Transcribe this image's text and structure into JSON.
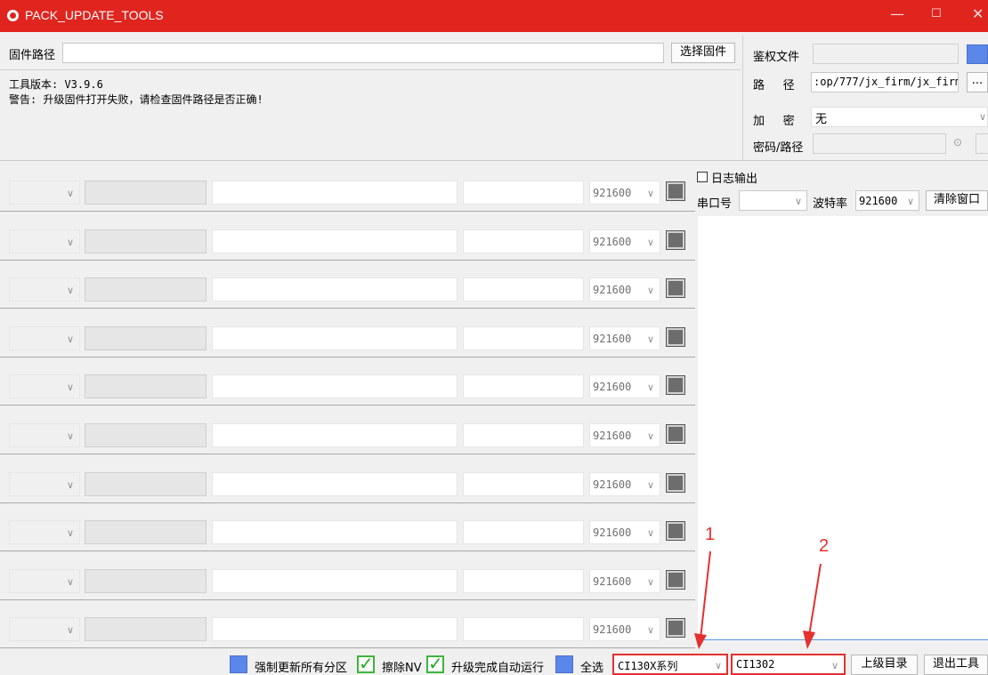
{
  "window": {
    "title": "PACK_UPDATE_TOOLS",
    "controls": [
      "—",
      "☐",
      "✕"
    ]
  },
  "top": {
    "firmware_path_label": "固件路径",
    "firmware_path_value": "",
    "select_firmware_button": "选择固件",
    "version_text": "工具版本: V3.9.6",
    "warning_text": "警告: 升级固件打开失败，请检查固件路径是否正确!"
  },
  "auth": {
    "auth_file_label": "鉴权文件",
    "path_label": "路     径",
    "path_value": ":op/777/jx_firm/jx_firm",
    "browse_button": "...",
    "encrypt_label": "加     密",
    "encrypt_value": "无",
    "password_label": "密码/路径"
  },
  "log": {
    "log_output_label": "日志输出",
    "port_label": "串口号",
    "baud_label": "波特率",
    "baud_value": "921600",
    "clear_button": "清除窗口"
  },
  "rows": [
    {
      "baud": "921600"
    },
    {
      "baud": "921600"
    },
    {
      "baud": "921600"
    },
    {
      "baud": "921600"
    },
    {
      "baud": "921600"
    },
    {
      "baud": "921600"
    },
    {
      "baud": "921600"
    },
    {
      "baud": "921600"
    },
    {
      "baud": "921600"
    },
    {
      "baud": "921600"
    }
  ],
  "bottom": {
    "force_update_label": "强制更新所有分区",
    "erase_nv_label": "擦除NV",
    "auto_run_label": "升级完成自动运行",
    "select_all_label": "全选",
    "series_select": "CI130X系列",
    "chip_select": "CI1302",
    "parent_dir_button": "上级目录",
    "exit_button": "退出工具"
  },
  "annotations": {
    "marker_1": "1",
    "marker_2": "2",
    "color": "#e53030"
  },
  "colors": {
    "titlebar": "#e0251f",
    "checkbox_blue": "#5b87ea",
    "check_green": "#3db53d"
  }
}
